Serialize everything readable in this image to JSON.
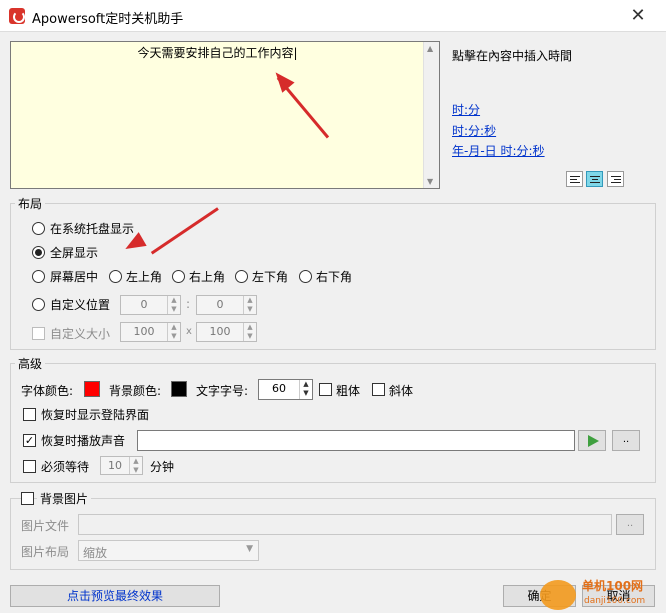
{
  "window": {
    "title": "Apowersoft定时关机助手",
    "close_glyph": "✕"
  },
  "editor": {
    "text": "今天需要安排自己的工作内容|",
    "accent": "#ffffe0"
  },
  "insert_time": {
    "heading": "點擊在內容中插入時間",
    "links": [
      "时:分",
      "时:分:秒",
      "年-月-日 时:分:秒"
    ]
  },
  "layout": {
    "legend": "布局",
    "tray": "在系统托盘显示",
    "fullscreen": "全屏显示",
    "center": "屏幕居中",
    "top_left": "左上角",
    "top_right": "右上角",
    "bottom_left": "左下角",
    "bottom_right": "右下角",
    "custom_pos": "自定义位置",
    "pos_x": "0",
    "pos_sep": ":",
    "pos_y": "0",
    "custom_size": "自定义大小",
    "size_w": "100",
    "size_sep": "x",
    "size_h": "100"
  },
  "advanced": {
    "legend": "高级",
    "font_color_label": "字体颜色:",
    "font_color": "#ff0000",
    "bg_color_label": "背景颜色:",
    "bg_color": "#000000",
    "font_size_label": "文字字号:",
    "font_size": "60",
    "bold": "粗体",
    "italic": "斜体",
    "show_login": "恢复时显示登陆界面",
    "play_sound": "恢复时播放声音",
    "browse": "..",
    "must_wait": "必须等待",
    "wait_value": "10",
    "minutes": "分钟"
  },
  "background": {
    "legend": "背景图片",
    "file_label": "图片文件",
    "browse": "..",
    "layout_label": "图片布局",
    "layout_value": "缩放"
  },
  "footer": {
    "preview": "点击预览最终效果",
    "ok": "确定",
    "cancel": "取消"
  },
  "watermark": {
    "site": "单机100网",
    "domain": "danji100.com"
  }
}
